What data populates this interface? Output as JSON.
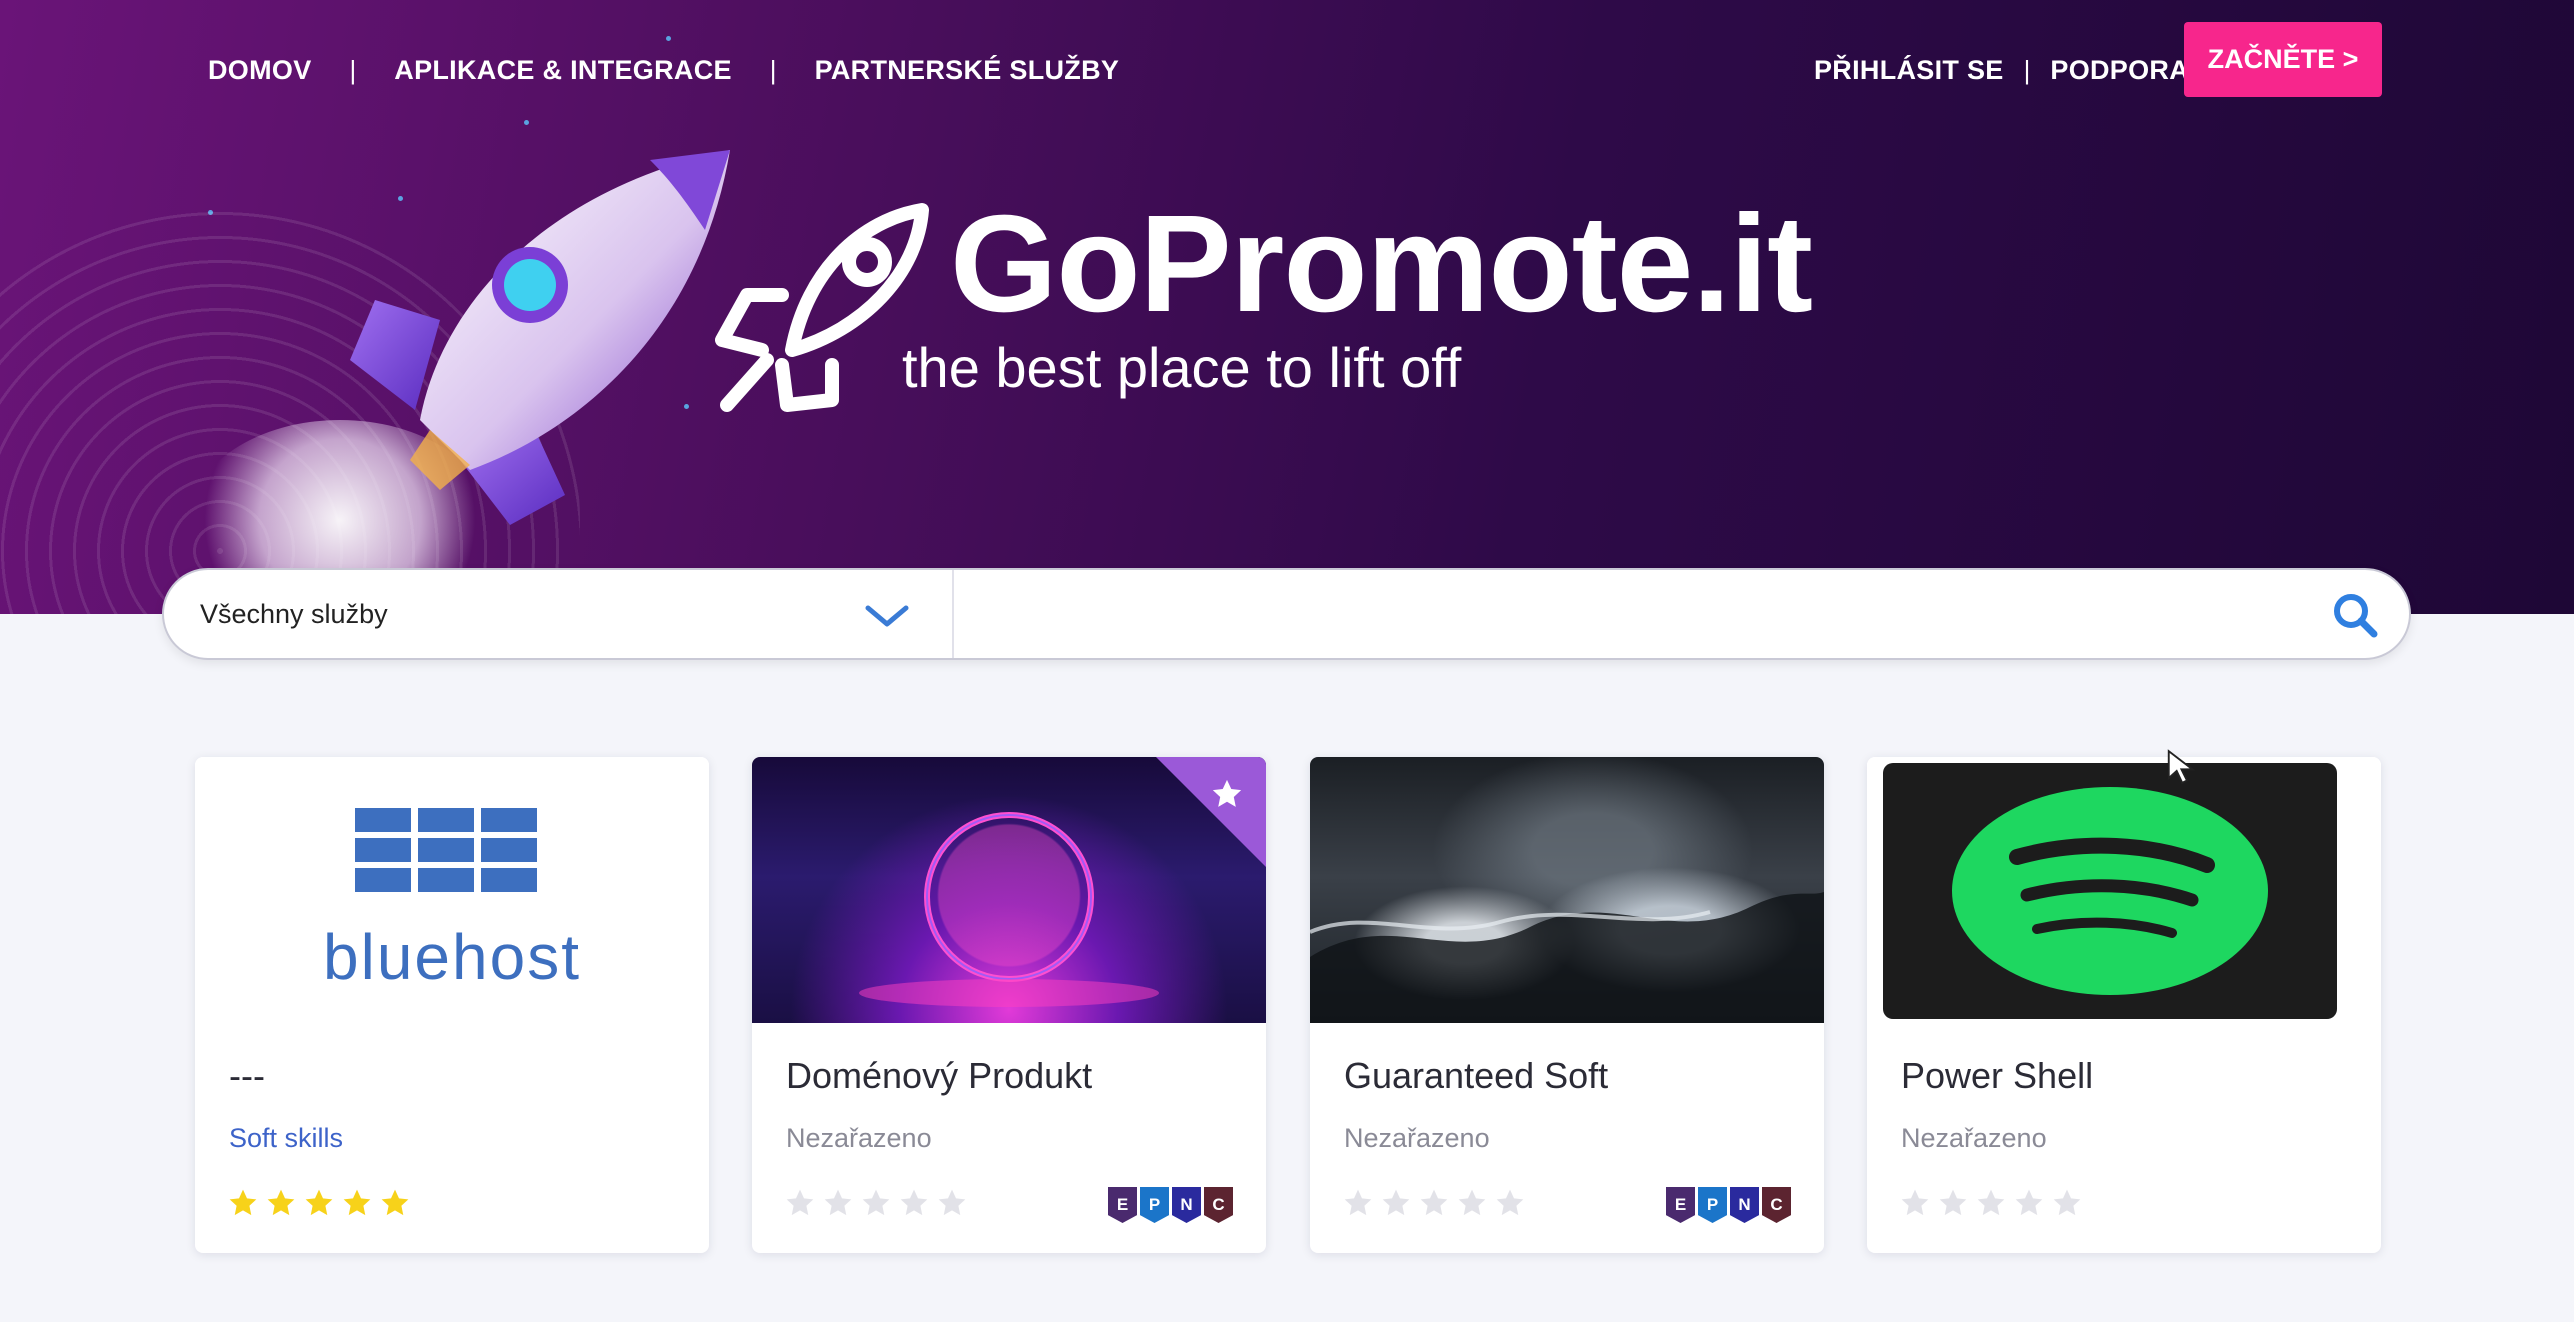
{
  "nav": {
    "left": [
      "DOMOV",
      "APLIKACE & INTEGRACE",
      "PARTNERSKÉ SLUŽBY"
    ],
    "separator": "|",
    "login": "PŘIHLÁSIT SE",
    "support": "PODPORA",
    "cta": "ZAČNĚTE >"
  },
  "hero": {
    "brand": "GoPromote.it",
    "tagline": "the best place to lift off"
  },
  "search": {
    "category_selected": "Všechny služby",
    "query": "",
    "placeholder": ""
  },
  "cards": [
    {
      "title": "---",
      "category": "Soft skills",
      "rating": 5,
      "image": "bluehost-logo",
      "logo_text": "bluehost",
      "featured": false,
      "badges": []
    },
    {
      "title": "Doménový Produkt",
      "category": "Nezařazeno",
      "rating": 0,
      "image": "neon-tunnel",
      "featured": true,
      "badges": [
        "E",
        "P",
        "N",
        "C"
      ]
    },
    {
      "title": "Guaranteed Soft",
      "category": "Nezařazeno",
      "rating": 0,
      "image": "dark-waves",
      "featured": false,
      "badges": [
        "E",
        "P",
        "N",
        "C"
      ]
    },
    {
      "title": "Power Shell",
      "category": "Nezařazeno",
      "rating": 0,
      "image": "spotify-logo",
      "featured": false,
      "badges": []
    }
  ],
  "colors": {
    "accent": "#f7268c",
    "hero_dark": "#2e0a48",
    "hero_purple": "#6a1478",
    "star_filled": "#f7d21a",
    "star_empty": "#e2e2e8",
    "link": "#3d63c9",
    "badge_e": "#4a2a6e",
    "badge_p": "#1b75c9",
    "badge_n": "#2a2a9e",
    "badge_c": "#5c2430"
  }
}
